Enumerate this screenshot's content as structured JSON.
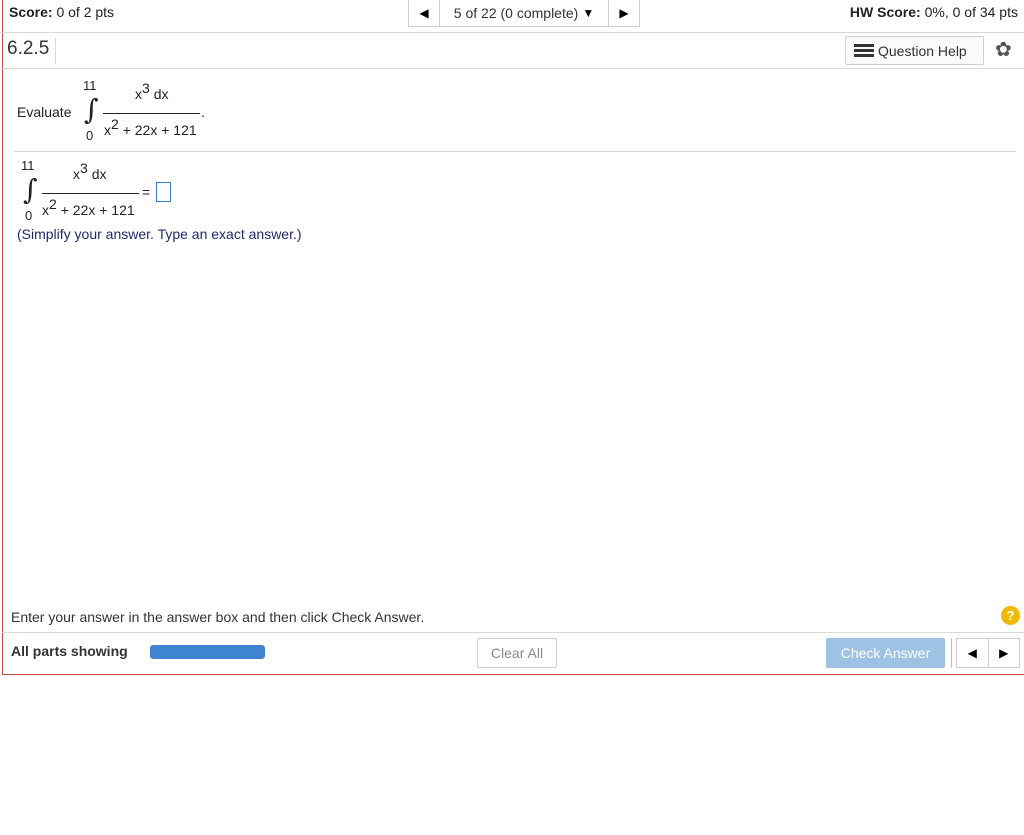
{
  "header": {
    "score_label": "Score:",
    "score_value": "0 of 2 pts",
    "nav_progress": "5 of 22 (0 complete)",
    "hw_score_label": "HW Score:",
    "hw_score_value": "0%, 0 of 34 pts"
  },
  "question": {
    "number": "6.2.5",
    "help_label": "Question Help",
    "prompt_word": "Evaluate",
    "integral": {
      "upper": "11",
      "lower": "0",
      "numerator": "x",
      "numerator_power": "3",
      "numerator_tail": "dx",
      "denominator_x": "x",
      "denominator_power": "2",
      "denominator_tail": "+ 22x + 121",
      "period": "."
    },
    "equals": "=",
    "hint": "(Simplify your answer. Type an exact answer.)"
  },
  "footer": {
    "instruction": "Enter your answer in the answer box and then click Check Answer.",
    "parts_label": "All parts showing",
    "progress_fraction": 1.0,
    "clear_label": "Clear All",
    "check_label": "Check Answer",
    "help_symbol": "?"
  },
  "colors": {
    "frame_border": "#c9474a",
    "progress_fill": "#3f84cf",
    "check_button": "#9ec2e4",
    "hint_text": "#1f2a6b",
    "help_circle": "#f2b800"
  }
}
